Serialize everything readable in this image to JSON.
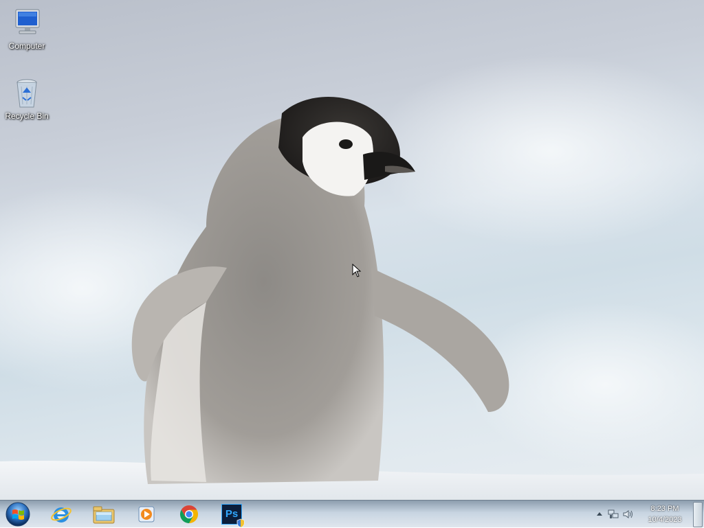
{
  "desktop": {
    "icons": [
      {
        "label": "Computer",
        "icon": "computer-icon"
      },
      {
        "label": "Recycle Bin",
        "icon": "recycle-bin-icon"
      }
    ],
    "wallpaper": "baby-penguin-wallpaper"
  },
  "taskbar": {
    "start_icon": "windows-start-orb",
    "pinned": [
      {
        "name": "Internet Explorer",
        "icon": "internet-explorer-icon"
      },
      {
        "name": "Windows Explorer",
        "icon": "file-explorer-icon"
      },
      {
        "name": "Windows Media Player",
        "icon": "media-player-icon"
      },
      {
        "name": "Google Chrome",
        "icon": "chrome-icon"
      },
      {
        "name": "Adobe Photoshop",
        "icon": "photoshop-icon",
        "text": "Ps"
      }
    ],
    "tray": {
      "icons": [
        "show-hidden-icons-arrow",
        "network-icon",
        "volume-icon"
      ],
      "time": "8:23 PM",
      "date": "10/4/2023"
    }
  },
  "colors": {
    "taskbar": "#b8c6d4",
    "chrome_red": "#db4437",
    "chrome_green": "#0f9d58",
    "chrome_yellow": "#f4b400",
    "chrome_blue": "#4285f4",
    "photoshop_blue": "#0b1e3b"
  }
}
